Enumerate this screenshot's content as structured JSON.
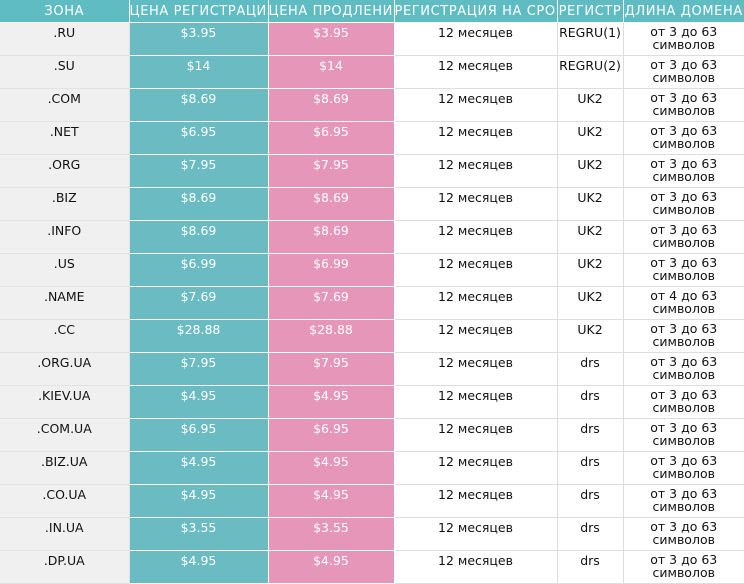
{
  "colors": {
    "header_bg": "#5fbcc2",
    "registration_bg": "#6bbcc2",
    "renewal_bg": "#e596b9",
    "zone_bg": "#f0f0f0"
  },
  "table": {
    "headers": {
      "zone": "ЗОНА",
      "registration_price": "ЦЕНА РЕГИСТРАЦИИ",
      "renewal_price": "ЦЕНА ПРОДЛЕНИЯ",
      "term": "РЕГИСТРАЦИЯ НА СРОК",
      "registrar": "РЕГИСТР",
      "length": "ДЛИНА ДОМЕНА"
    },
    "rows": [
      {
        "zone": ".RU",
        "reg": "$3.95",
        "renew": "$3.95",
        "term": "12 месяцев",
        "registrar": "REGRU(1)",
        "length": "от 3 до 63 символов"
      },
      {
        "zone": ".SU",
        "reg": "$14",
        "renew": "$14",
        "term": "12 месяцев",
        "registrar": "REGRU(2)",
        "length": "от 3 до 63 символов"
      },
      {
        "zone": ".COM",
        "reg": "$8.69",
        "renew": "$8.69",
        "term": "12 месяцев",
        "registrar": "UK2",
        "length": "от 3 до 63 символов"
      },
      {
        "zone": ".NET",
        "reg": "$6.95",
        "renew": "$6.95",
        "term": "12 месяцев",
        "registrar": "UK2",
        "length": "от 3 до 63 символов"
      },
      {
        "zone": ".ORG",
        "reg": "$7.95",
        "renew": "$7.95",
        "term": "12 месяцев",
        "registrar": "UK2",
        "length": "от 3 до 63 символов"
      },
      {
        "zone": ".BIZ",
        "reg": "$8.69",
        "renew": "$8.69",
        "term": "12 месяцев",
        "registrar": "UK2",
        "length": "от 3 до 63 символов"
      },
      {
        "zone": ".INFO",
        "reg": "$8.69",
        "renew": "$8.69",
        "term": "12 месяцев",
        "registrar": "UK2",
        "length": "от 3 до 63 символов"
      },
      {
        "zone": ".US",
        "reg": "$6.99",
        "renew": "$6.99",
        "term": "12 месяцев",
        "registrar": "UK2",
        "length": "от 3 до 63 символов"
      },
      {
        "zone": ".NAME",
        "reg": "$7.69",
        "renew": "$7.69",
        "term": "12 месяцев",
        "registrar": "UK2",
        "length": "от 4 до 63 символов"
      },
      {
        "zone": ".CC",
        "reg": "$28.88",
        "renew": "$28.88",
        "term": "12 месяцев",
        "registrar": "UK2",
        "length": "от 3 до 63 символов"
      },
      {
        "zone": ".ORG.UA",
        "reg": "$7.95",
        "renew": "$7.95",
        "term": "12 месяцев",
        "registrar": "drs",
        "length": "от 3 до 63 символов"
      },
      {
        "zone": ".KIEV.UA",
        "reg": "$4.95",
        "renew": "$4.95",
        "term": "12 месяцев",
        "registrar": "drs",
        "length": "от 3 до 63 символов"
      },
      {
        "zone": ".COM.UA",
        "reg": "$6.95",
        "renew": "$6.95",
        "term": "12 месяцев",
        "registrar": "drs",
        "length": "от 3 до 63 символов"
      },
      {
        "zone": ".BIZ.UA",
        "reg": "$4.95",
        "renew": "$4.95",
        "term": "12 месяцев",
        "registrar": "drs",
        "length": "от 3 до 63 символов"
      },
      {
        "zone": ".CO.UA",
        "reg": "$4.95",
        "renew": "$4.95",
        "term": "12 месяцев",
        "registrar": "drs",
        "length": "от 3 до 63 символов"
      },
      {
        "zone": ".IN.UA",
        "reg": "$3.55",
        "renew": "$3.55",
        "term": "12 месяцев",
        "registrar": "drs",
        "length": "от 3 до 63 символов"
      },
      {
        "zone": ".DP.UA",
        "reg": "$4.95",
        "renew": "$4.95",
        "term": "12 месяцев",
        "registrar": "drs",
        "length": "от 3 до 63 символов"
      }
    ]
  }
}
